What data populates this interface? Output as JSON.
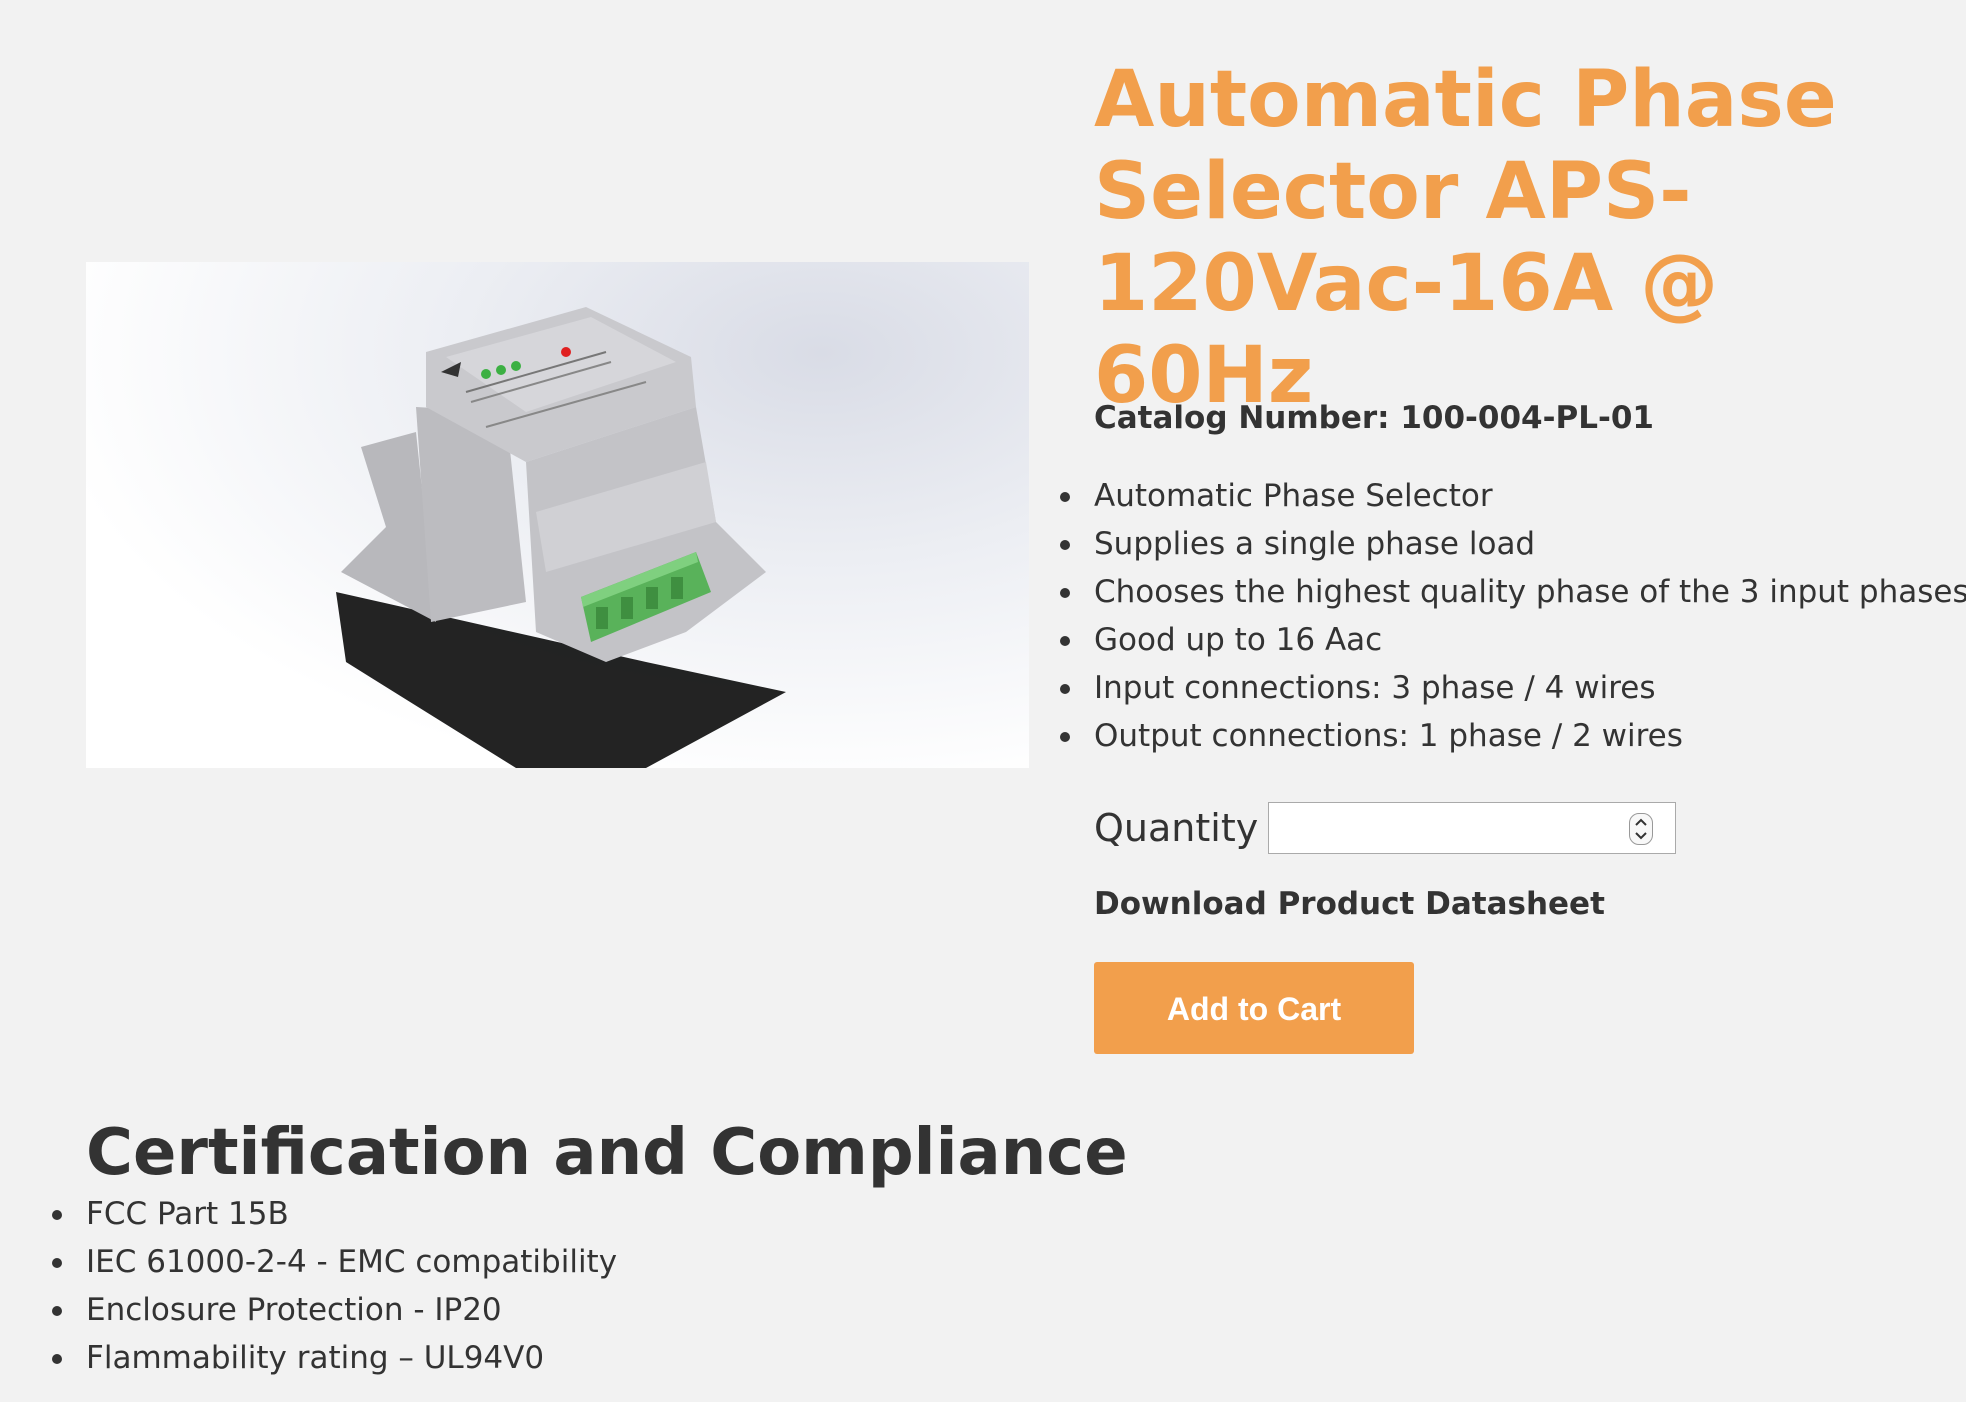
{
  "product": {
    "title": "Automatic Phase Selector APS-120Vac-16A @ 60Hz",
    "catalog": "Catalog Number: 100-004-PL-01",
    "image": "product-photo",
    "features": [
      "Automatic Phase Selector",
      "Supplies a single phase load",
      "Chooses the highest quality phase of the 3 input phases",
      "Good up to 16 Aac",
      "Input connections: 3 phase / 4 wires",
      "Output connections: 1 phase / 2 wires"
    ]
  },
  "purchase": {
    "quantity_label": "Quantity",
    "quantity_value": "",
    "download_label": "Download Product Datasheet",
    "cart_label": "Add to Cart"
  },
  "certification": {
    "heading": "Certification and Compliance",
    "items": [
      "FCC Part 15B",
      "IEC 61000-2-4 - EMC compatibility",
      "Enclosure Protection - IP20",
      "Flammability rating – UL94V0"
    ]
  },
  "colors": {
    "accent": "#f29f4c",
    "text": "#333333",
    "background": "#f2f2f2"
  }
}
